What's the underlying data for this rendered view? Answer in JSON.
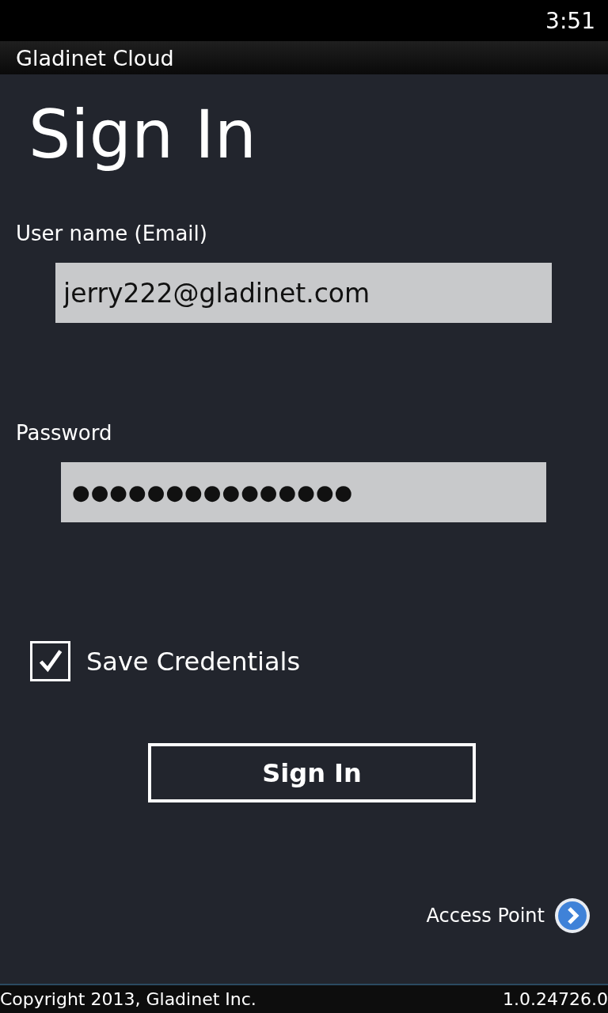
{
  "status_bar": {
    "time": "3:51"
  },
  "app_bar": {
    "title": "Gladinet Cloud"
  },
  "page": {
    "title": "Sign In"
  },
  "form": {
    "username": {
      "label": "User name (Email)",
      "value": "jerry222@gladinet.com"
    },
    "password": {
      "label": "Password",
      "value": "●●●●●●●●●●●●●●●"
    },
    "save_credentials": {
      "label": "Save Credentials",
      "checked": true
    },
    "submit": {
      "label": "Sign In"
    }
  },
  "access_point": {
    "label": "Access Point"
  },
  "footer": {
    "copyright": "Copyright 2013, Gladinet Inc.",
    "version": "1.0.24726.0"
  }
}
